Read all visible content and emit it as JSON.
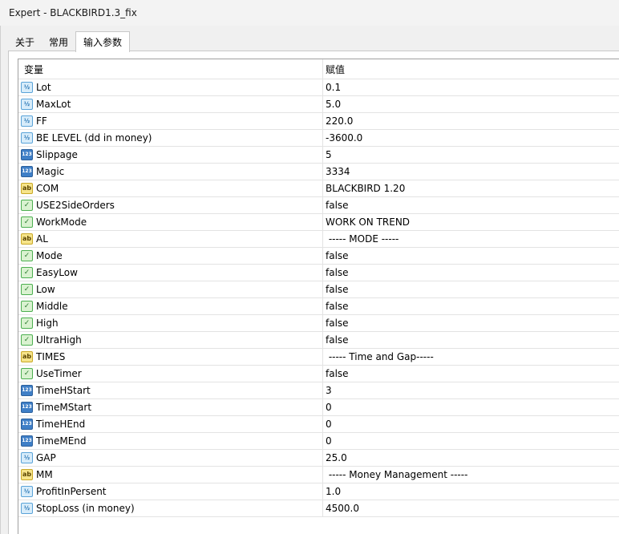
{
  "window": {
    "title": "Expert - BLACKBIRD1.3_fix"
  },
  "tabs": [
    {
      "label": "关于",
      "active": false
    },
    {
      "label": "常用",
      "active": false
    },
    {
      "label": "输入参数",
      "active": true
    }
  ],
  "table": {
    "headers": {
      "name": "变量",
      "value": "赋值"
    },
    "rows": [
      {
        "type": "float",
        "icon": "float-param-icon",
        "name": "Lot",
        "value": "0.1"
      },
      {
        "type": "float",
        "icon": "float-param-icon",
        "name": "MaxLot",
        "value": "5.0"
      },
      {
        "type": "float",
        "icon": "float-param-icon",
        "name": "FF",
        "value": "220.0"
      },
      {
        "type": "float",
        "icon": "float-param-icon",
        "name": "BE LEVEL (dd in money)",
        "value": "-3600.0"
      },
      {
        "type": "int",
        "icon": "int-param-icon",
        "name": "Slippage",
        "value": "5"
      },
      {
        "type": "int",
        "icon": "int-param-icon",
        "name": "Magic",
        "value": "3334"
      },
      {
        "type": "str",
        "icon": "string-param-icon",
        "name": "COM",
        "value": "BLACKBIRD 1.20"
      },
      {
        "type": "bool",
        "icon": "bool-param-icon",
        "name": "USE2SideOrders",
        "value": "false"
      },
      {
        "type": "bool",
        "icon": "bool-param-icon",
        "name": "WorkMode",
        "value": "WORK ON TREND"
      },
      {
        "type": "str",
        "icon": "string-param-icon",
        "name": "AL",
        "value": " ----- MODE -----"
      },
      {
        "type": "bool",
        "icon": "bool-param-icon",
        "name": "Mode",
        "value": "false"
      },
      {
        "type": "bool",
        "icon": "bool-param-icon",
        "name": "EasyLow",
        "value": "false"
      },
      {
        "type": "bool",
        "icon": "bool-param-icon",
        "name": "Low",
        "value": "false"
      },
      {
        "type": "bool",
        "icon": "bool-param-icon",
        "name": "Middle",
        "value": "false"
      },
      {
        "type": "bool",
        "icon": "bool-param-icon",
        "name": "High",
        "value": "false"
      },
      {
        "type": "bool",
        "icon": "bool-param-icon",
        "name": "UltraHigh",
        "value": "false"
      },
      {
        "type": "str",
        "icon": "string-param-icon",
        "name": "TIMES",
        "value": " ----- Time and Gap-----"
      },
      {
        "type": "bool",
        "icon": "bool-param-icon",
        "name": "UseTimer",
        "value": "false"
      },
      {
        "type": "int",
        "icon": "int-param-icon",
        "name": "TimeHStart",
        "value": "3"
      },
      {
        "type": "int",
        "icon": "int-param-icon",
        "name": "TimeMStart",
        "value": "0"
      },
      {
        "type": "int",
        "icon": "int-param-icon",
        "name": "TimeHEnd",
        "value": "0"
      },
      {
        "type": "int",
        "icon": "int-param-icon",
        "name": "TimeMEnd",
        "value": "0"
      },
      {
        "type": "float",
        "icon": "float-param-icon",
        "name": "GAP",
        "value": "25.0"
      },
      {
        "type": "str",
        "icon": "string-param-icon",
        "name": "MM",
        "value": " ----- Money Management -----"
      },
      {
        "type": "float",
        "icon": "float-param-icon",
        "name": "ProfitInPersent",
        "value": "1.0"
      },
      {
        "type": "float",
        "icon": "float-param-icon",
        "name": "StopLoss (in money)",
        "value": "4500.0"
      }
    ]
  }
}
